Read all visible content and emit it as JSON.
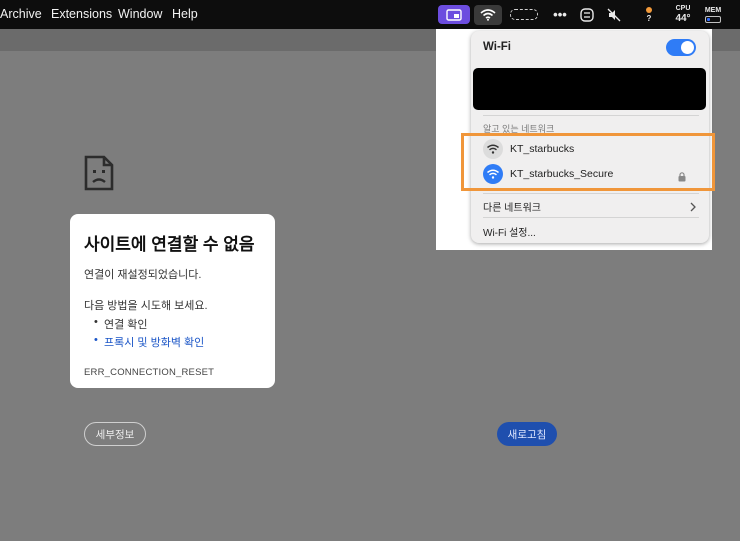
{
  "menubar": {
    "items": [
      "Archive",
      "Extensions",
      "Window",
      "Help"
    ],
    "cpu_label": "CPU",
    "cpu_value": "44°",
    "mem_label": "MEM",
    "question": "?"
  },
  "error_page": {
    "title": "사이트에 연결할 수 없음",
    "message": "연결이 재설정되었습니다.",
    "suggestion_intro": "다음 방법을 시도해 보세요.",
    "suggestions": [
      "연결 확인",
      "프록시 및 방화벽 확인"
    ],
    "error_code": "ERR_CONNECTION_RESET",
    "details_button": "세부정보",
    "reload_button": "새로고침"
  },
  "wifi_menu": {
    "title": "Wi-Fi",
    "toggle_on": true,
    "known_networks_label": "알고 있는 네트워크",
    "networks": [
      {
        "name": "KT_starbucks",
        "icon": "wifi-icon",
        "active": false,
        "locked": false
      },
      {
        "name": "KT_starbucks_Secure",
        "icon": "wifi-icon",
        "active": true,
        "locked": true
      }
    ],
    "other_networks": "다른 네트워크",
    "settings": "Wi-Fi 설정..."
  },
  "colors": {
    "accent_blue": "#2f7cf6",
    "highlight_orange": "#f0963a",
    "menubar_highlight": "#6c4ddf"
  }
}
